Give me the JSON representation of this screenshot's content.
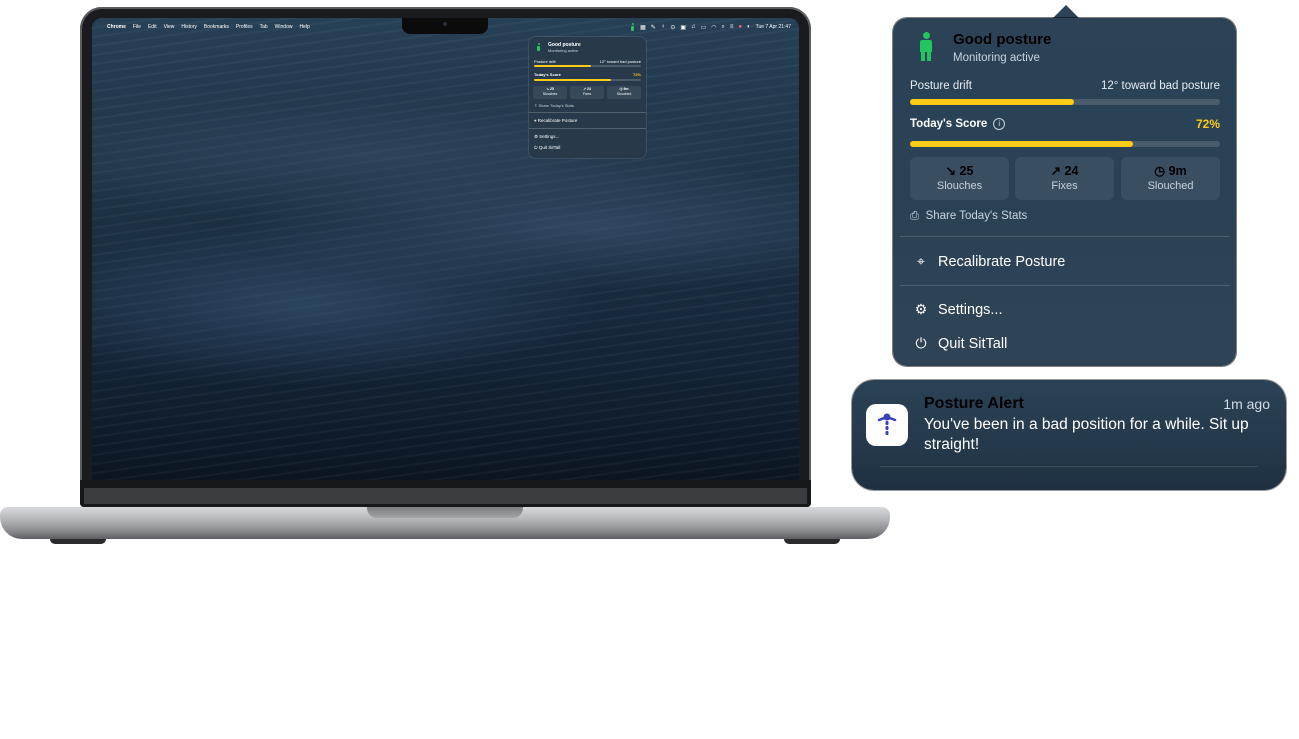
{
  "menubar": {
    "apple": "",
    "items": [
      "Chrome",
      "File",
      "Edit",
      "View",
      "History",
      "Bookmarks",
      "Profiles",
      "Tab",
      "Window",
      "Help"
    ],
    "clock": "Tue 7 Apr  21:47"
  },
  "popup": {
    "status_title": "Good posture",
    "status_subtitle": "Monitoring active",
    "drift_label": "Posture drift",
    "drift_value": "12° toward bad posture",
    "drift_level": 0.53,
    "score_label": "Today's Score",
    "score_value": "72%",
    "score_level": 0.72,
    "stats": [
      {
        "value": "↘ 25",
        "label": "Slouches"
      },
      {
        "value": "↗ 24",
        "label": "Fixes"
      },
      {
        "value": "◷ 9m",
        "label": "Slouched"
      }
    ],
    "share_label": "Share Today's Stats",
    "recalibrate_label": "Recalibrate Posture",
    "settings_label": "Settings...",
    "quit_label": "Quit SitTall",
    "accent_color": "#facc15",
    "status_color": "#22c55e"
  },
  "notification": {
    "title": "Posture Alert",
    "time": "1m ago",
    "body": "You've been in a bad position for a while. Sit up straight!"
  }
}
